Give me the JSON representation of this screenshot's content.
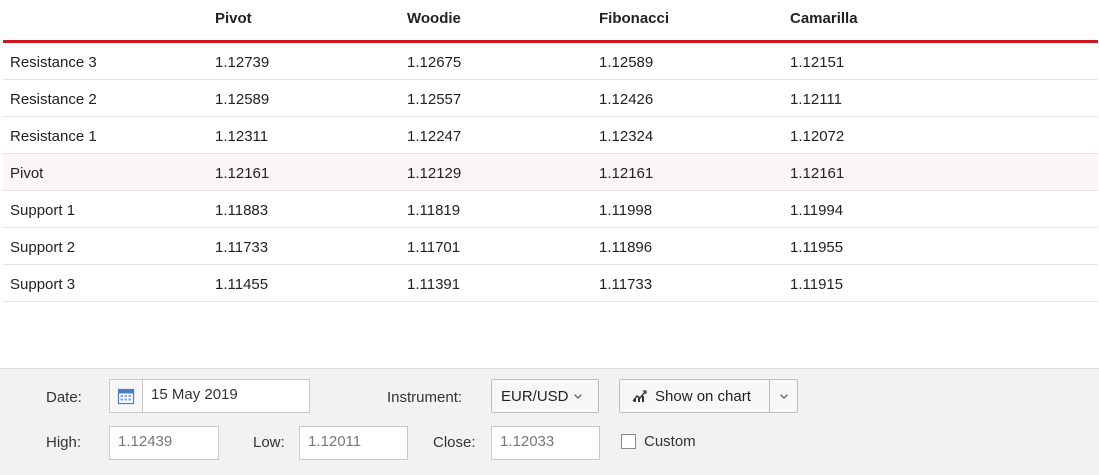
{
  "table": {
    "headers": [
      "",
      "Pivot",
      "Woodie",
      "Fibonacci",
      "Camarilla"
    ],
    "rows": [
      {
        "label": "Resistance 3",
        "values": [
          "1.12739",
          "1.12675",
          "1.12589",
          "1.12151"
        ]
      },
      {
        "label": "Resistance 2",
        "values": [
          "1.12589",
          "1.12557",
          "1.12426",
          "1.12111"
        ]
      },
      {
        "label": "Resistance 1",
        "values": [
          "1.12311",
          "1.12247",
          "1.12324",
          "1.12072"
        ]
      },
      {
        "label": "Pivot",
        "values": [
          "1.12161",
          "1.12129",
          "1.12161",
          "1.12161"
        ]
      },
      {
        "label": "Support 1",
        "values": [
          "1.11883",
          "1.11819",
          "1.11998",
          "1.11994"
        ]
      },
      {
        "label": "Support 2",
        "values": [
          "1.11733",
          "1.11701",
          "1.11896",
          "1.11955"
        ]
      },
      {
        "label": "Support 3",
        "values": [
          "1.11455",
          "1.11391",
          "1.11733",
          "1.11915"
        ]
      }
    ],
    "accent_color": "#d0161c"
  },
  "controls": {
    "date_label": "Date:",
    "date_value": "15 May 2019",
    "instrument_label": "Instrument:",
    "instrument_value": "EUR/USD",
    "show_chart_label": "Show on chart",
    "high_label": "High:",
    "high_value": "1.12439",
    "low_label": "Low:",
    "low_value": "1.12011",
    "close_label": "Close:",
    "close_value": "1.12033",
    "custom_label": "Custom",
    "custom_checked": false
  },
  "icons": {
    "calendar": "calendar-icon",
    "chart": "chart-icon",
    "dropdown": "chevron-down-icon"
  }
}
